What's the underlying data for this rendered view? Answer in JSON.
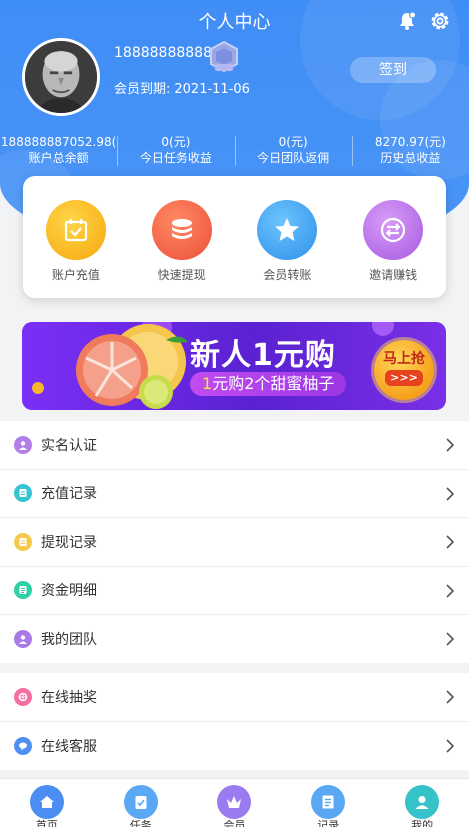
{
  "header": {
    "title": "个人中心",
    "bell_icon": "bell-icon",
    "settings_icon": "gear-icon"
  },
  "profile": {
    "phone": "18888888888",
    "expire_label": "会员到期:",
    "expire_date": "2021-11-06",
    "checkin_label": "签到"
  },
  "stats": [
    {
      "value": "188888887052.98(",
      "label": "账户总余额"
    },
    {
      "value": "0(元)",
      "label": "今日任务收益"
    },
    {
      "value": "0(元)",
      "label": "今日团队返佣"
    },
    {
      "value": "8270.97(元)",
      "label": "历史总收益"
    }
  ],
  "actions": [
    {
      "label": "账户充值",
      "icon": "calendar-check-icon",
      "color": "#f8b90c"
    },
    {
      "label": "快速提现",
      "icon": "coins-stack-icon",
      "color": "#f0624a"
    },
    {
      "label": "会员转账",
      "icon": "star-icon",
      "color": "#3aa3f0"
    },
    {
      "label": "邀请赚钱",
      "icon": "exchange-icon",
      "color": "#b66ee8"
    }
  ],
  "banner": {
    "title": "新人1元购",
    "subtitle_highlight": "1",
    "subtitle_rest": "元购2个甜蜜柚子",
    "button_label": "马上抢",
    "button_arrows": ">>>"
  },
  "menu_group_1": [
    {
      "label": "实名认证",
      "icon": "user-verify-icon",
      "color": "#a979e6"
    },
    {
      "label": "充值记录",
      "icon": "recharge-record-icon",
      "color": "#35c6d2"
    },
    {
      "label": "提现记录",
      "icon": "withdraw-record-icon",
      "color": "#f6c94a"
    },
    {
      "label": "资金明细",
      "icon": "funds-detail-icon",
      "color": "#2fd1a8"
    },
    {
      "label": "我的团队",
      "icon": "team-icon",
      "color": "#a979e6"
    }
  ],
  "menu_group_2": [
    {
      "label": "在线抽奖",
      "icon": "lottery-icon",
      "color": "#f46fa3"
    },
    {
      "label": "在线客服",
      "icon": "customer-service-icon",
      "color": "#4f8ff2"
    }
  ],
  "tabbar": [
    {
      "label": "首页",
      "icon": "home-icon",
      "color": "#4b8df2"
    },
    {
      "label": "任务",
      "icon": "task-icon",
      "color": "#5aa8f3"
    },
    {
      "label": "会员",
      "icon": "crown-icon",
      "color": "#9b7cf0"
    },
    {
      "label": "记录",
      "icon": "record-icon",
      "color": "#5aa8f3"
    },
    {
      "label": "我的",
      "icon": "profile-icon",
      "color": "#35c2c8"
    }
  ]
}
